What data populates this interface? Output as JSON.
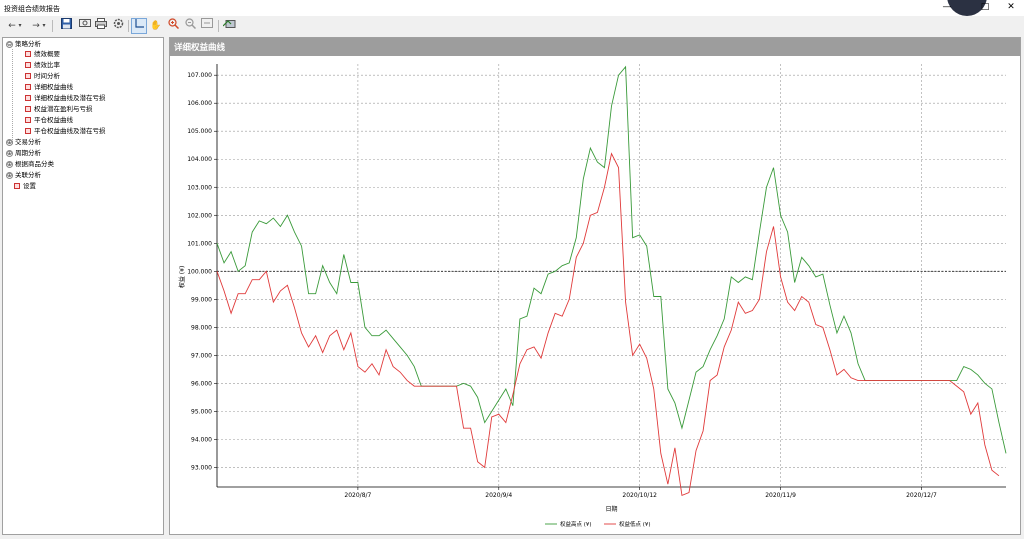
{
  "window": {
    "title": "投资组合绩效报告",
    "controls": {
      "minimize": "—",
      "maximize": "□",
      "close": "✕"
    }
  },
  "toolbar": {
    "icons": [
      "back-icon",
      "dropdown-icon",
      "forward-icon",
      "dropdown-icon",
      "save-icon",
      "export-icon",
      "print-icon",
      "settings-icon",
      "cursor-icon",
      "pan-icon",
      "zoom-in-icon",
      "zoom-out-icon",
      "fit-icon",
      "legend-icon"
    ]
  },
  "tree": {
    "groups": [
      {
        "label": "策略分析",
        "expander": "⊖",
        "children": [
          "绩效概要",
          "绩效比率",
          "时间分析",
          "详细权益曲线",
          "详细权益曲线及潜在亏损",
          "权益潜在盈利与亏损",
          "平仓权益曲线",
          "平仓权益曲线及潜在亏损"
        ]
      },
      {
        "label": "交易分析",
        "expander": "⊕",
        "children": []
      },
      {
        "label": "周期分析",
        "expander": "⊕",
        "children": []
      },
      {
        "label": "根据商品分类",
        "expander": "⊕",
        "children": []
      },
      {
        "label": "关联分析",
        "expander": "⊕",
        "children": []
      }
    ],
    "extra_item": "设置"
  },
  "panel": {
    "title": "详细权益曲线"
  },
  "chart_data": {
    "type": "line",
    "title": "",
    "xlabel": "日期",
    "ylabel": "权益 (¥)",
    "ylim": [
      92.3,
      107.4
    ],
    "yticks": [
      93,
      94,
      95,
      96,
      97,
      98,
      99,
      100,
      101,
      102,
      103,
      104,
      105,
      106,
      107
    ],
    "ytick_labels": [
      "93.000",
      "94.000",
      "95.000",
      "96.000",
      "97.000",
      "98.000",
      "99.000",
      "100.000",
      "101.000",
      "102.000",
      "103.000",
      "104.000",
      "105.000",
      "106.000",
      "107.000"
    ],
    "xlim": [
      0,
      112
    ],
    "xticks": [
      20,
      40,
      60,
      80,
      100
    ],
    "xtick_labels": [
      "2020/8/7",
      "2020/9/4",
      "2020/10/12",
      "2020/11/9",
      "2020/12/7"
    ],
    "reference_line": 100,
    "grid": true,
    "legend_placement": "bottom-center",
    "series": [
      {
        "name": "权益高点 (¥)",
        "color": "#3a9a3a",
        "y": [
          101.0,
          100.3,
          100.7,
          100.0,
          100.2,
          101.4,
          101.8,
          101.7,
          101.9,
          101.6,
          102.0,
          101.4,
          100.9,
          99.2,
          99.2,
          100.2,
          99.6,
          99.2,
          100.6,
          99.6,
          99.6,
          98.0,
          97.7,
          97.7,
          97.9,
          97.6,
          97.3,
          97.0,
          96.6,
          95.9,
          95.9,
          95.9,
          95.9,
          95.9,
          95.9,
          96.0,
          95.9,
          95.5,
          94.6,
          95.0,
          95.4,
          95.8,
          95.2,
          98.3,
          98.4,
          99.4,
          99.2,
          99.9,
          100.0,
          100.2,
          100.3,
          101.2,
          103.3,
          104.4,
          103.9,
          103.7,
          105.9,
          107.0,
          107.3,
          101.2,
          101.3,
          100.9,
          99.1,
          99.1,
          95.8,
          95.3,
          94.4,
          95.4,
          96.4,
          96.6,
          97.2,
          97.7,
          98.3,
          99.8,
          99.6,
          99.8,
          99.7,
          101.4,
          103.0,
          103.7,
          102.0,
          101.4,
          99.6,
          100.5,
          100.2,
          99.8,
          99.9,
          98.8,
          97.8,
          98.4,
          97.8,
          96.7,
          96.1,
          96.1,
          96.1,
          96.1,
          96.1,
          96.1,
          96.1,
          96.1,
          96.1,
          96.1,
          96.1,
          96.1,
          96.1,
          96.1,
          96.6,
          96.5,
          96.3,
          96.0,
          95.8,
          94.6,
          93.5
        ]
      },
      {
        "name": "权益低点 (¥)",
        "color": "#e03a3a",
        "y": [
          100.0,
          99.3,
          98.5,
          99.2,
          99.2,
          99.7,
          99.7,
          100.0,
          98.9,
          99.3,
          99.5,
          98.7,
          97.8,
          97.3,
          97.7,
          97.1,
          97.7,
          97.9,
          97.2,
          97.8,
          96.6,
          96.4,
          96.7,
          96.3,
          97.2,
          96.6,
          96.4,
          96.1,
          95.9,
          95.9,
          95.9,
          95.9,
          95.9,
          95.9,
          95.9,
          94.4,
          94.4,
          93.2,
          93.0,
          94.8,
          94.9,
          94.6,
          95.6,
          96.7,
          97.2,
          97.3,
          96.9,
          97.8,
          98.5,
          98.4,
          99.0,
          100.5,
          101.0,
          102.0,
          102.1,
          103.0,
          104.2,
          103.7,
          98.9,
          97.0,
          97.4,
          96.9,
          95.8,
          93.5,
          92.4,
          93.7,
          92.0,
          92.1,
          93.6,
          94.3,
          96.1,
          96.3,
          97.3,
          97.9,
          98.9,
          98.5,
          98.6,
          99.0,
          100.7,
          101.6,
          99.8,
          98.9,
          98.6,
          99.1,
          98.9,
          98.1,
          98.0,
          97.2,
          96.3,
          96.5,
          96.2,
          96.1,
          96.1,
          96.1,
          96.1,
          96.1,
          96.1,
          96.1,
          96.1,
          96.1,
          96.1,
          96.1,
          96.1,
          96.1,
          96.1,
          95.9,
          95.7,
          94.9,
          95.3,
          93.8,
          92.9,
          92.7
        ]
      }
    ]
  }
}
